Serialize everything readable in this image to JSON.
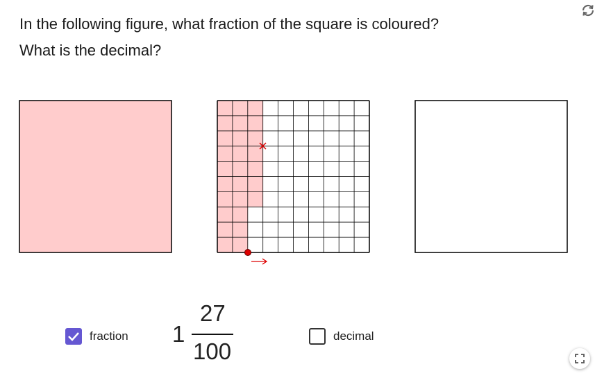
{
  "question": {
    "line1": "In the following figure, what fraction of the square is coloured?",
    "line2": "What is the decimal?"
  },
  "figure": {
    "grid_rows": 10,
    "grid_cols": 10,
    "shaded_cells": 127,
    "colors": {
      "shaded_fill": "#ffcccc",
      "grid_line": "#000000",
      "point_red": "#dd0000"
    },
    "point_marker": "point-dot",
    "drag_cross_icon": "x-mark-icon",
    "direction_arrow": "right-arrow-icon"
  },
  "controls": {
    "fraction": {
      "label": "fraction",
      "checked": true
    },
    "decimal": {
      "label": "decimal",
      "checked": false
    }
  },
  "answer": {
    "whole": "1",
    "numerator": "27",
    "denominator": "100"
  },
  "icons": {
    "reset": "reset-icon",
    "fullscreen": "fullscreen-icon"
  },
  "colors": {
    "checkbox_accent": "#6557d2"
  }
}
